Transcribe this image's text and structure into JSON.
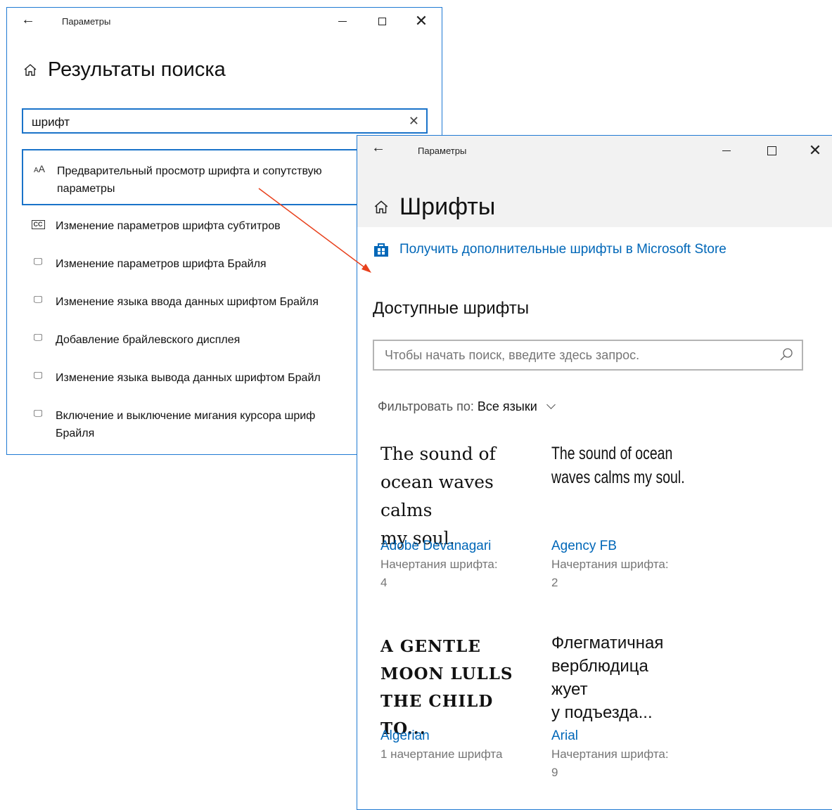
{
  "colors": {
    "accent": "#1a73c9",
    "link": "#0067b8",
    "arrow": "#e8401c"
  },
  "search_window": {
    "title": "Параметры",
    "header": "Результаты поиска",
    "search_value": "шрифт",
    "results": [
      {
        "icon": "font-preview-icon",
        "glyph": "AA",
        "label": "Предварительный просмотр шрифта и сопутствую\nпараметры"
      },
      {
        "icon": "closed-captions-icon",
        "glyph": "CC",
        "label": "Изменение параметров шрифта субтитров"
      },
      {
        "icon": "braille-display-icon",
        "glyph": "🖵",
        "label": "Изменение параметров шрифта Брайля"
      },
      {
        "icon": "braille-display-icon",
        "glyph": "🖵",
        "label": "Изменение языка ввода данных шрифтом Брайля"
      },
      {
        "icon": "braille-display-icon",
        "glyph": "🖵",
        "label": "Добавление брайлевского дисплея"
      },
      {
        "icon": "braille-display-icon",
        "glyph": "🖵",
        "label": "Изменение языка вывода данных шрифтом Брайл"
      },
      {
        "icon": "braille-display-icon",
        "glyph": "🖵",
        "label": "Включение и выключение мигания курсора шриф\nБрайля"
      }
    ]
  },
  "fonts_window": {
    "title": "Параметры",
    "header": "Шрифты",
    "store_link": "Получить дополнительные шрифты в Microsoft Store",
    "available_title": "Доступные шрифты",
    "search_placeholder": "Чтобы начать поиск, введите здесь запрос.",
    "filter_label": "Фильтровать по:",
    "filter_value": "Все языки",
    "fonts": [
      {
        "preview": "The sound of\nocean waves calms\nmy soul.",
        "name": "Adobe Devanagari",
        "styles": "Начертания шрифта:\n4"
      },
      {
        "preview": "The sound of ocean\nwaves calms my soul.",
        "name": "Agency FB",
        "styles": "Начертания шрифта:\n2"
      },
      {
        "preview": "A GENTLE\nMOON LULLS\nTHE CHILD TO...",
        "name": "Algerian",
        "styles": "1 начертание шрифта"
      },
      {
        "preview": "Флегматичная\nверблюдица\nжует\nу подъезда...",
        "name": "Arial",
        "styles": "Начертания шрифта:\n9"
      }
    ]
  }
}
